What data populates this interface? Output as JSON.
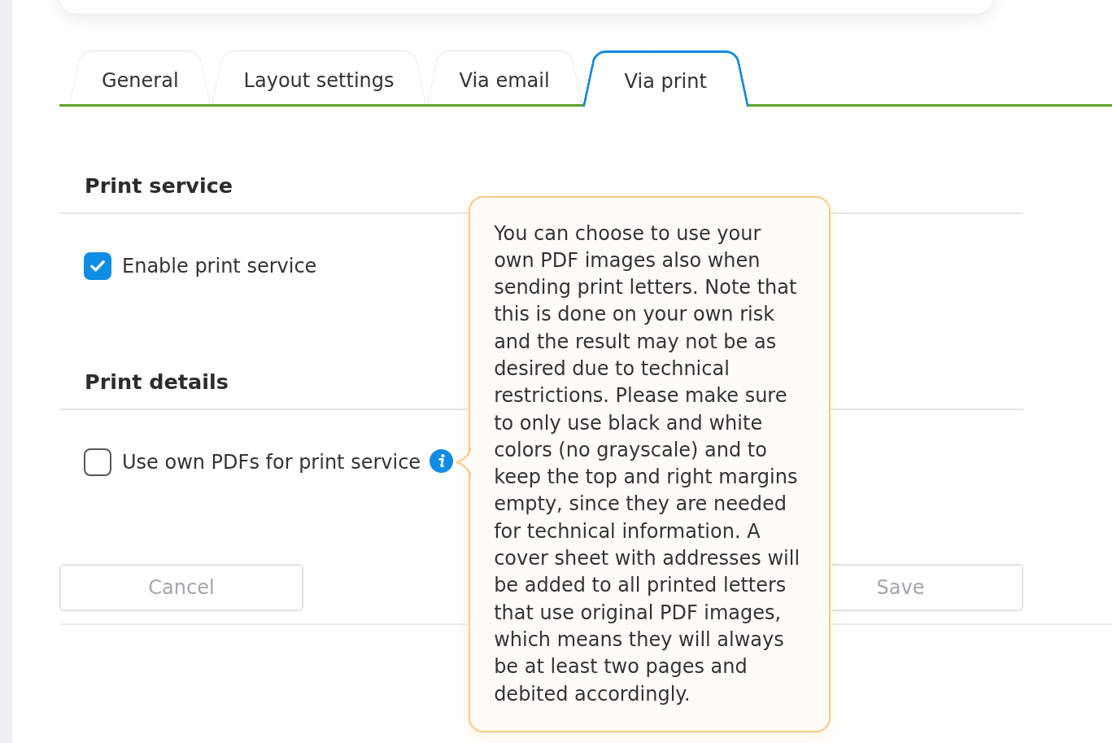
{
  "tabs": [
    {
      "label": "General",
      "selected": false
    },
    {
      "label": "Layout settings",
      "selected": false
    },
    {
      "label": "Via email",
      "selected": false
    },
    {
      "label": "Via print",
      "selected": true
    }
  ],
  "sections": [
    {
      "title": "Print service",
      "options": [
        {
          "label": "Enable print service",
          "checked": true
        }
      ]
    },
    {
      "title": "Print details",
      "options": [
        {
          "label": "Use own PDFs for print service",
          "checked": false,
          "info": {
            "tooltip": "You can choose to use your own PDF images also when sending print letters. Note that this is done on your own risk and the result may not be as desired due to technical restrictions. Please make sure to only use black and white colors (no grayscale) and to keep the top and right margins empty, since they are needed for technical information. A cover sheet with addresses will be added to all printed letters that use original PDF images, which means they will always be at least two pages and debited accordingly."
          }
        }
      ]
    }
  ],
  "buttons": [
    {
      "label": "Cancel",
      "disabled": true
    },
    {
      "label": "Save",
      "disabled": true
    }
  ]
}
